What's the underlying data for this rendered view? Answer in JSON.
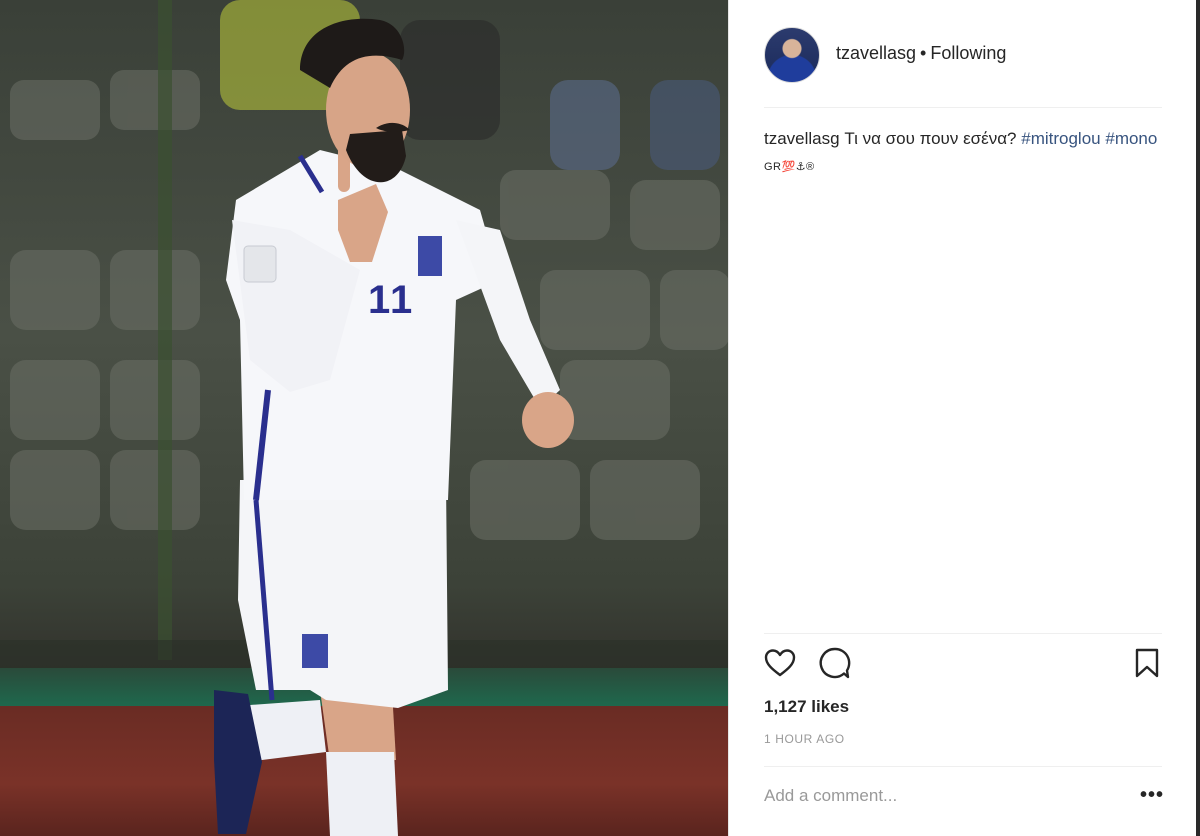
{
  "post": {
    "username": "tzavellasg",
    "follow_status": "Following",
    "caption": {
      "username": "tzavellasg",
      "text": "Τι να σου πουν εσένα?",
      "hashtags": [
        "#mitroglou",
        "#mono"
      ],
      "trailing": "GR💯⚓®"
    },
    "likes": "1,127 likes",
    "time": "1 HOUR AGO",
    "comment_placeholder": "Add a comment...",
    "more_label": "•••",
    "photo": {
      "jersey_number": "11"
    }
  },
  "colors": {
    "accent_link": "#38547f",
    "text": "#262626",
    "muted": "#999999",
    "jersey_blue": "#2a2f8e"
  },
  "icons": {
    "like": "heart-icon",
    "comment": "speech-bubble-icon",
    "save": "bookmark-icon"
  }
}
